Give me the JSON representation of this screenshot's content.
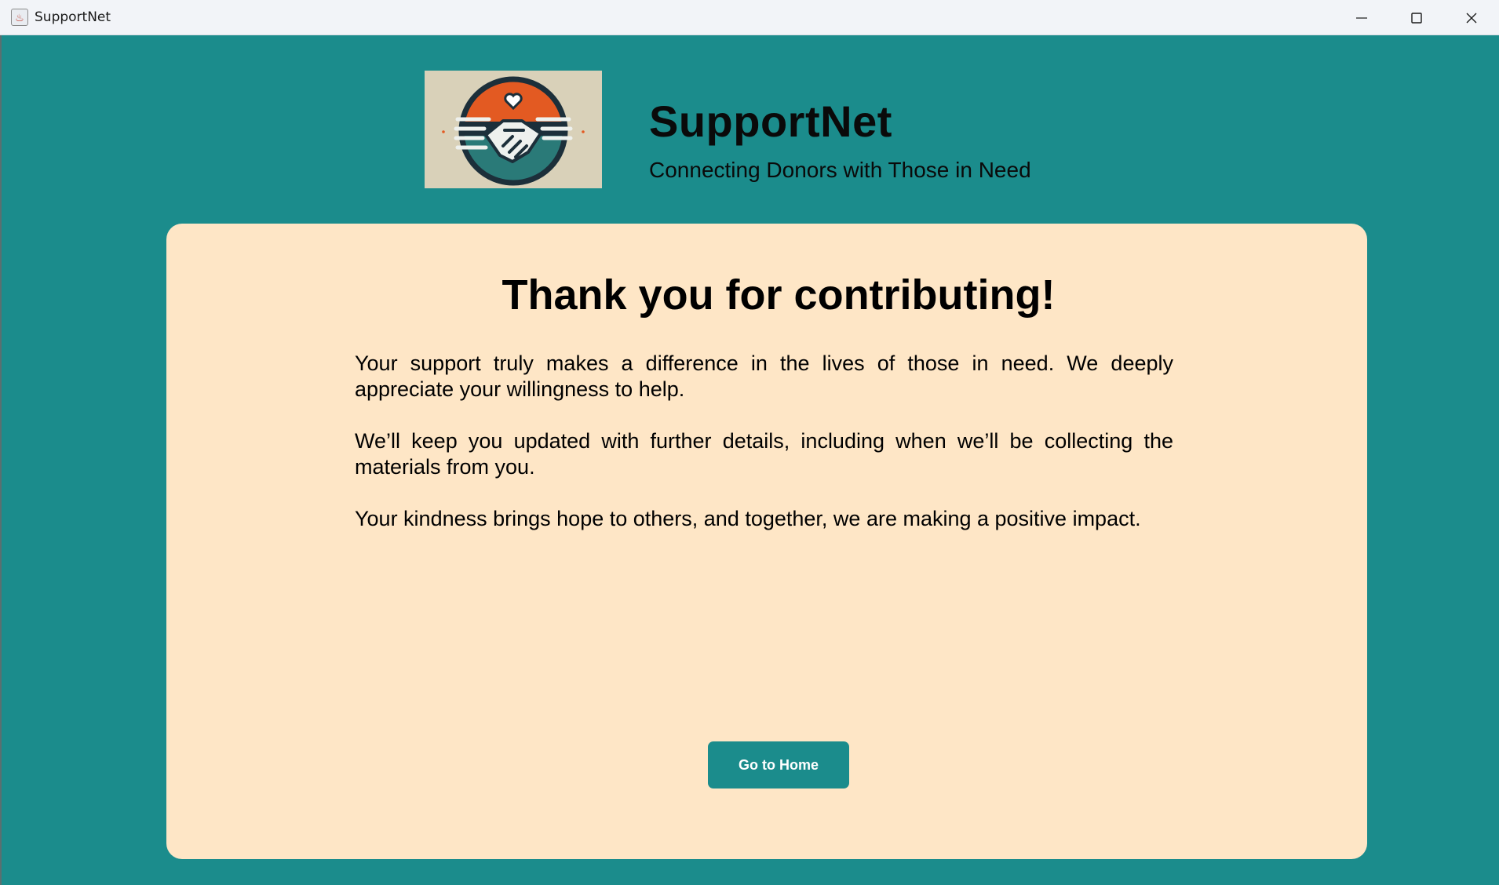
{
  "window": {
    "title": "SupportNet",
    "controls": [
      "minimize",
      "maximize",
      "close"
    ]
  },
  "header": {
    "logo_icon": "handshake-heart-logo",
    "brand_name": "SupportNet",
    "tagline": "Connecting Donors with Those in Need"
  },
  "card": {
    "heading": "Thank you for contributing!",
    "paragraphs": [
      "Your support truly makes a difference in the lives of those in need. We deeply appreciate your willingness to help.",
      "We’ll keep you updated with further details, including when we’ll be collecting the materials from you.",
      "Your kindness brings hope to others, and together, we are making a positive impact."
    ],
    "home_button_label": "Go to Home"
  },
  "colors": {
    "background": "#1b8c8c",
    "card": "#fee6c6",
    "button": "#1b8c8c",
    "logo_orange": "#e35a22",
    "logo_teal": "#2a7a78",
    "logo_dark": "#1c2f3a"
  }
}
